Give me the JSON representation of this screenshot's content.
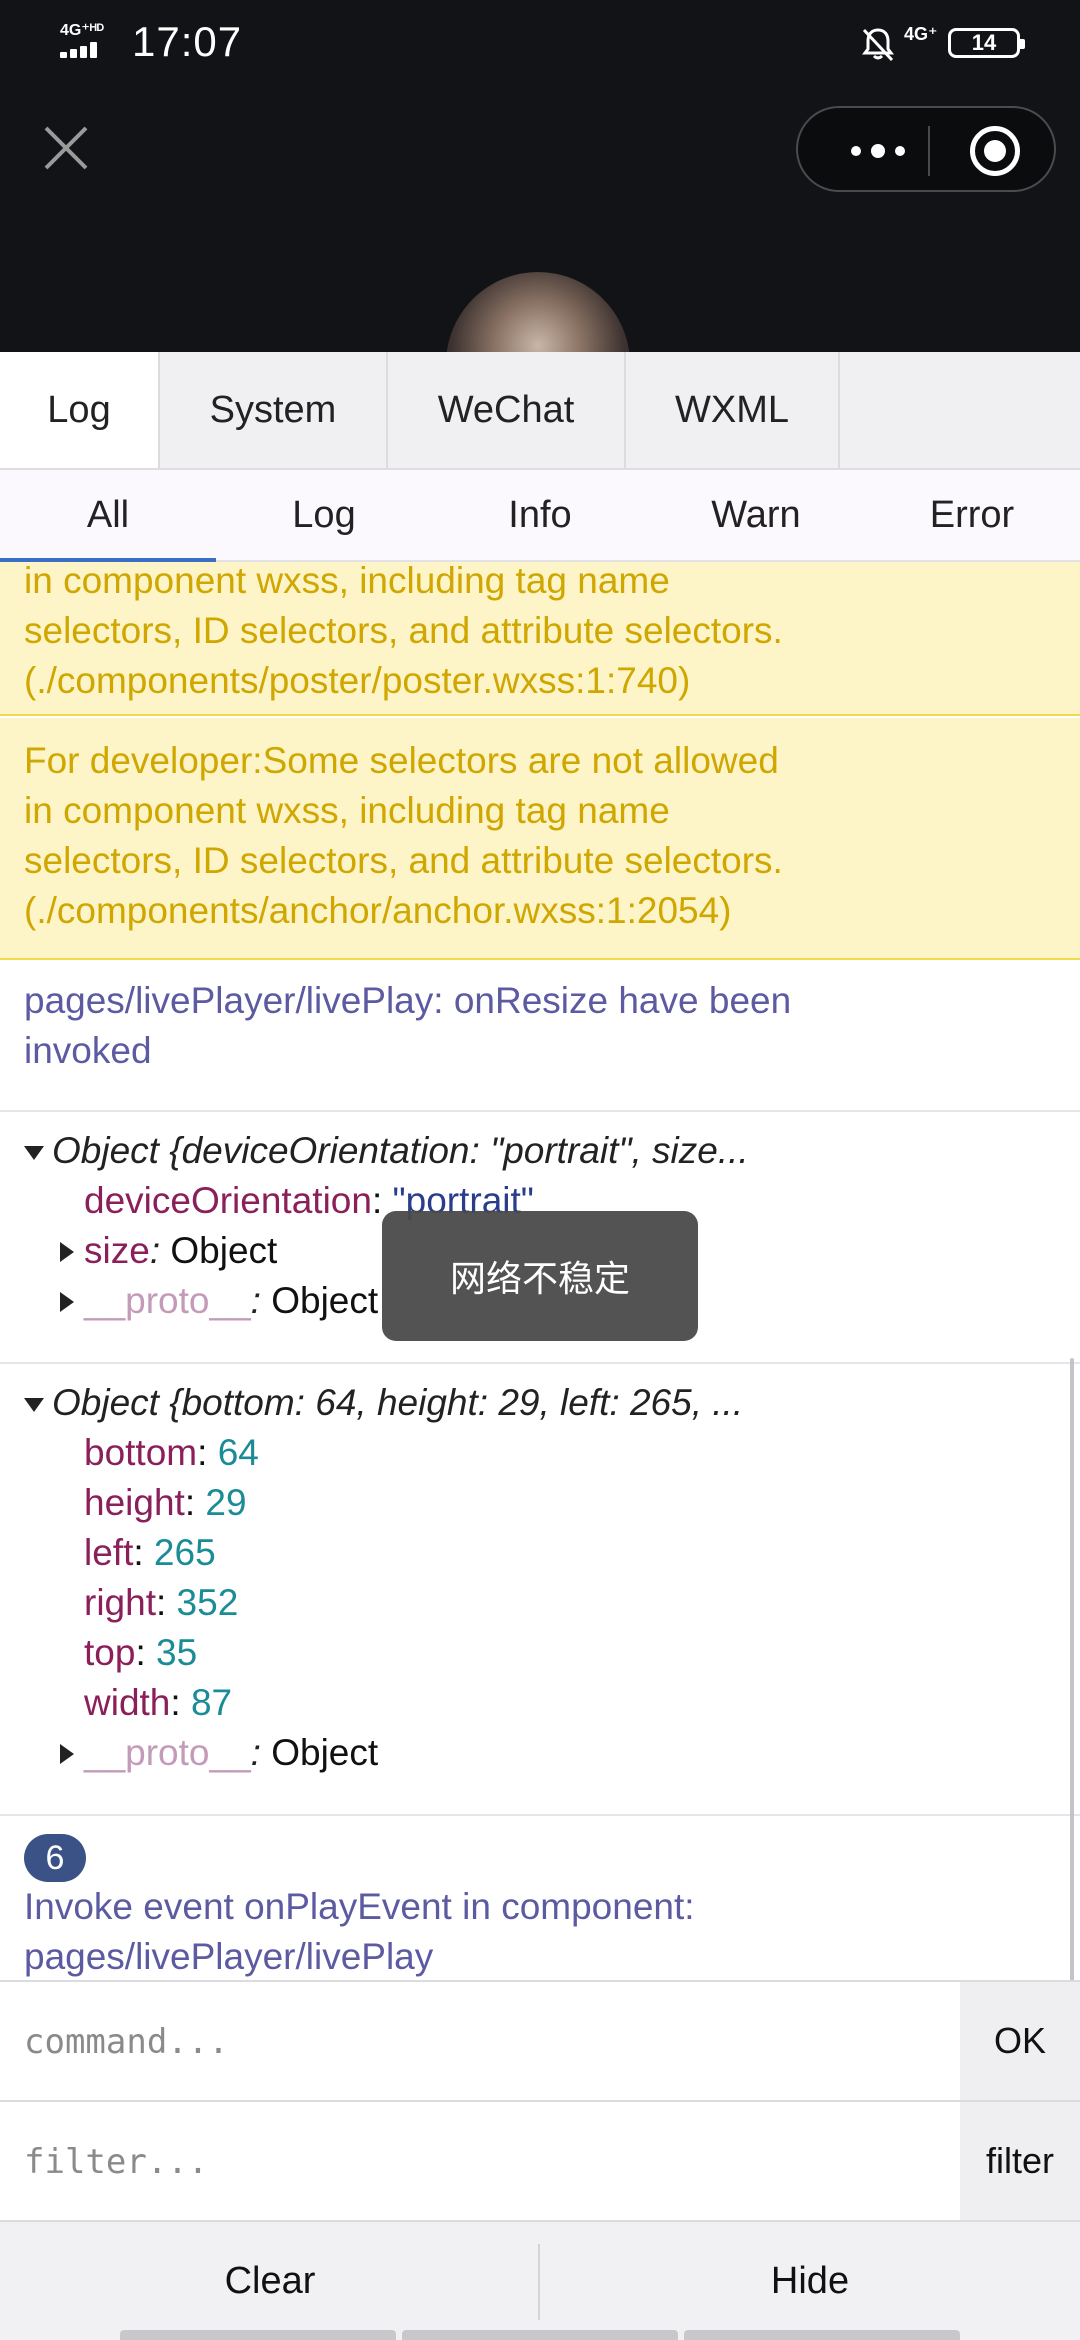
{
  "status_bar": {
    "network": "4G⁺ᴴᴰ",
    "time": "17:07",
    "network_right": "4G⁺",
    "battery": "14"
  },
  "tabs": [
    {
      "label": "Log",
      "active": true
    },
    {
      "label": "System",
      "active": false
    },
    {
      "label": "WeChat",
      "active": false
    },
    {
      "label": "WXML",
      "active": false
    }
  ],
  "subtabs": [
    {
      "label": "All",
      "active": true
    },
    {
      "label": "Log",
      "active": false
    },
    {
      "label": "Info",
      "active": false
    },
    {
      "label": "Warn",
      "active": false
    },
    {
      "label": "Error",
      "active": false
    }
  ],
  "logs": {
    "warn1": {
      "lines": [
        "in component wxss, including tag name",
        "selectors, ID selectors, and attribute selectors.",
        "(./components/poster/poster.wxss:1:740)"
      ]
    },
    "warn2": {
      "lines": [
        "For developer:Some selectors are not allowed",
        "in component wxss, including tag name",
        "selectors, ID selectors, and attribute selectors.",
        "(./components/anchor/anchor.wxss:1:2054)"
      ]
    },
    "info1": {
      "lines": [
        "pages/livePlayer/livePlay: onResize have been",
        "invoked"
      ]
    },
    "obj1": {
      "header": "Object {deviceOrientation: \"portrait\", size...",
      "props": [
        {
          "key": "deviceOrientation",
          "value": "\"portrait\""
        }
      ],
      "collapsed": [
        {
          "key": "size",
          "value": "Object"
        },
        {
          "key": "__proto__",
          "value": "Object"
        }
      ]
    },
    "obj2": {
      "header": "Object {bottom: 64, height: 29, left: 265, ...",
      "props": [
        {
          "key": "bottom",
          "value": "64"
        },
        {
          "key": "height",
          "value": "29"
        },
        {
          "key": "left",
          "value": "265"
        },
        {
          "key": "right",
          "value": "352"
        },
        {
          "key": "top",
          "value": "35"
        },
        {
          "key": "width",
          "value": "87"
        }
      ],
      "collapsed": [
        {
          "key": "__proto__",
          "value": "Object"
        }
      ]
    },
    "info2": {
      "badge": "6",
      "lines": [
        "Invoke event onPlayEvent in component:",
        "pages/livePlayer/livePlay"
      ]
    }
  },
  "toast": "网络不稳定",
  "command": {
    "placeholder": "command...",
    "button": "OK"
  },
  "filter": {
    "placeholder": "filter...",
    "button": "filter"
  },
  "bottom_bar": {
    "clear": "Clear",
    "hide": "Hide"
  }
}
